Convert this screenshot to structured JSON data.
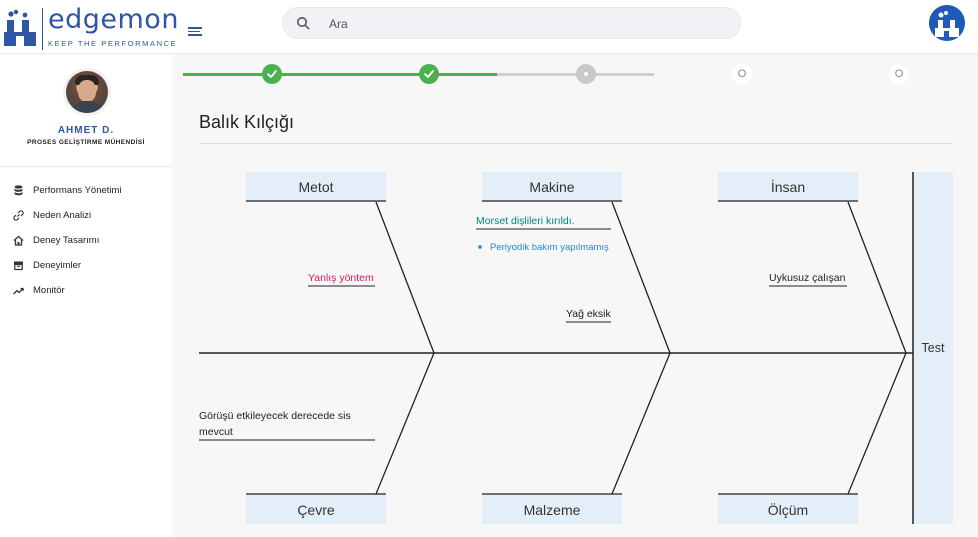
{
  "header": {
    "brand": "edgemon",
    "tagline": "KEEP THE PERFORMANCE",
    "search": {
      "placeholder": "Ara",
      "value": ""
    }
  },
  "profile": {
    "name": "AHMET D.",
    "role": "PROSES GELİŞTİRME MÜHENDİSİ"
  },
  "sidebar": {
    "items": [
      {
        "label": "Performans Yönetimi",
        "icon": "database-icon"
      },
      {
        "label": "Neden Analizi",
        "icon": "link-icon"
      },
      {
        "label": "Deney Tasarımı",
        "icon": "home-icon"
      },
      {
        "label": "Deneyimler",
        "icon": "archive-icon"
      },
      {
        "label": "Monitör",
        "icon": "trend-icon"
      }
    ]
  },
  "stepper": {
    "steps": [
      {
        "state": "done",
        "label": ""
      },
      {
        "state": "done",
        "label": ""
      },
      {
        "state": "current",
        "label": ""
      },
      {
        "state": "pending",
        "label": "O"
      },
      {
        "state": "pending",
        "label": "O"
      }
    ],
    "colors": {
      "done": "#4caf50",
      "pending": "#cfcfcf"
    }
  },
  "page": {
    "title": "Balık Kılçığı"
  },
  "fishbone": {
    "head": "Test",
    "categories": {
      "top": [
        "Metot",
        "Makine",
        "İnsan"
      ],
      "bottom": [
        "Çevre",
        "Malzeme",
        "Ölçüm"
      ]
    },
    "causes": {
      "metot": {
        "text": "Yanlış yöntem",
        "color": "#d81b60"
      },
      "makine_main": {
        "text": "Morset dişlileri kırıldı.",
        "color": "#00897b"
      },
      "makine_sub": {
        "text": "Periyodik bakım yapılmamış",
        "color": "#1e88e5"
      },
      "makine_second": {
        "text": "Yağ eksik",
        "color": "#222222"
      },
      "insan": {
        "text": "Uykusuz çalışan",
        "color": "#222222"
      },
      "cevre_line1": {
        "text": "Görüşü etkileyecek derecede sis",
        "color": "#222222"
      },
      "cevre_line2": {
        "text": "mevcut",
        "color": "#222222"
      }
    },
    "colors": {
      "box_fill": "#e3eef8",
      "spine": "#222222"
    }
  }
}
